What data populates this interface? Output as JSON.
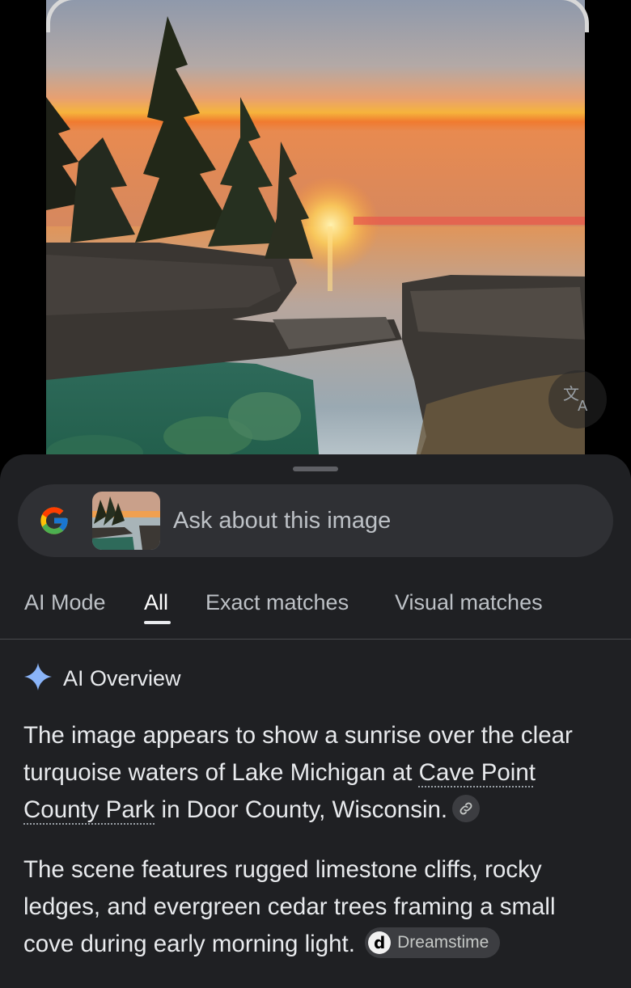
{
  "search": {
    "placeholder": "Ask about this image"
  },
  "tabs": [
    {
      "label": "AI Mode",
      "active": false
    },
    {
      "label": "All",
      "active": true
    },
    {
      "label": "Exact matches",
      "active": false
    },
    {
      "label": "Visual matches",
      "active": false
    }
  ],
  "overview": {
    "title": "AI Overview",
    "p1_before": "The image appears to show a sunrise over the clear turquoise waters of Lake Michigan at ",
    "p1_link": "Cave Point County Park",
    "p1_after": " in Door County, Wisconsin.",
    "p2": "The scene features rugged limestone cliffs, rocky ledges, and evergreen cedar trees framing a small cove during early morning light.",
    "source": "Dreamstime",
    "source_letter": "d"
  },
  "icons": {
    "translate": "translate-icon",
    "google": "google-logo-icon",
    "sparkle": "sparkle-icon",
    "link": "link-icon"
  },
  "colors": {
    "sheet_bg": "#1f2023",
    "search_bg": "#2f3034",
    "sparkle": "#8ab4f8"
  }
}
